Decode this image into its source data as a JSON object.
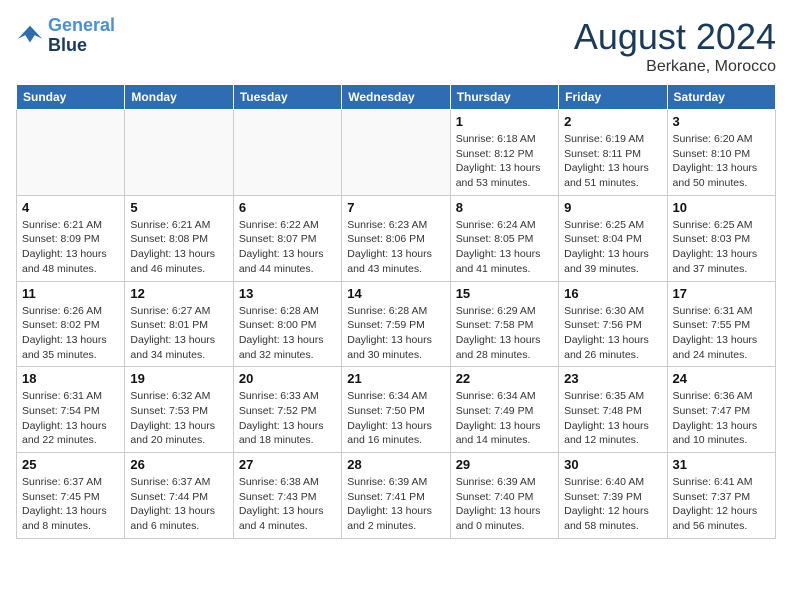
{
  "logo": {
    "line1": "General",
    "line2": "Blue"
  },
  "title": "August 2024",
  "location": "Berkane, Morocco",
  "weekdays": [
    "Sunday",
    "Monday",
    "Tuesday",
    "Wednesday",
    "Thursday",
    "Friday",
    "Saturday"
  ],
  "weeks": [
    [
      {
        "day": "",
        "info": ""
      },
      {
        "day": "",
        "info": ""
      },
      {
        "day": "",
        "info": ""
      },
      {
        "day": "",
        "info": ""
      },
      {
        "day": "1",
        "info": "Sunrise: 6:18 AM\nSunset: 8:12 PM\nDaylight: 13 hours\nand 53 minutes."
      },
      {
        "day": "2",
        "info": "Sunrise: 6:19 AM\nSunset: 8:11 PM\nDaylight: 13 hours\nand 51 minutes."
      },
      {
        "day": "3",
        "info": "Sunrise: 6:20 AM\nSunset: 8:10 PM\nDaylight: 13 hours\nand 50 minutes."
      }
    ],
    [
      {
        "day": "4",
        "info": "Sunrise: 6:21 AM\nSunset: 8:09 PM\nDaylight: 13 hours\nand 48 minutes."
      },
      {
        "day": "5",
        "info": "Sunrise: 6:21 AM\nSunset: 8:08 PM\nDaylight: 13 hours\nand 46 minutes."
      },
      {
        "day": "6",
        "info": "Sunrise: 6:22 AM\nSunset: 8:07 PM\nDaylight: 13 hours\nand 44 minutes."
      },
      {
        "day": "7",
        "info": "Sunrise: 6:23 AM\nSunset: 8:06 PM\nDaylight: 13 hours\nand 43 minutes."
      },
      {
        "day": "8",
        "info": "Sunrise: 6:24 AM\nSunset: 8:05 PM\nDaylight: 13 hours\nand 41 minutes."
      },
      {
        "day": "9",
        "info": "Sunrise: 6:25 AM\nSunset: 8:04 PM\nDaylight: 13 hours\nand 39 minutes."
      },
      {
        "day": "10",
        "info": "Sunrise: 6:25 AM\nSunset: 8:03 PM\nDaylight: 13 hours\nand 37 minutes."
      }
    ],
    [
      {
        "day": "11",
        "info": "Sunrise: 6:26 AM\nSunset: 8:02 PM\nDaylight: 13 hours\nand 35 minutes."
      },
      {
        "day": "12",
        "info": "Sunrise: 6:27 AM\nSunset: 8:01 PM\nDaylight: 13 hours\nand 34 minutes."
      },
      {
        "day": "13",
        "info": "Sunrise: 6:28 AM\nSunset: 8:00 PM\nDaylight: 13 hours\nand 32 minutes."
      },
      {
        "day": "14",
        "info": "Sunrise: 6:28 AM\nSunset: 7:59 PM\nDaylight: 13 hours\nand 30 minutes."
      },
      {
        "day": "15",
        "info": "Sunrise: 6:29 AM\nSunset: 7:58 PM\nDaylight: 13 hours\nand 28 minutes."
      },
      {
        "day": "16",
        "info": "Sunrise: 6:30 AM\nSunset: 7:56 PM\nDaylight: 13 hours\nand 26 minutes."
      },
      {
        "day": "17",
        "info": "Sunrise: 6:31 AM\nSunset: 7:55 PM\nDaylight: 13 hours\nand 24 minutes."
      }
    ],
    [
      {
        "day": "18",
        "info": "Sunrise: 6:31 AM\nSunset: 7:54 PM\nDaylight: 13 hours\nand 22 minutes."
      },
      {
        "day": "19",
        "info": "Sunrise: 6:32 AM\nSunset: 7:53 PM\nDaylight: 13 hours\nand 20 minutes."
      },
      {
        "day": "20",
        "info": "Sunrise: 6:33 AM\nSunset: 7:52 PM\nDaylight: 13 hours\nand 18 minutes."
      },
      {
        "day": "21",
        "info": "Sunrise: 6:34 AM\nSunset: 7:50 PM\nDaylight: 13 hours\nand 16 minutes."
      },
      {
        "day": "22",
        "info": "Sunrise: 6:34 AM\nSunset: 7:49 PM\nDaylight: 13 hours\nand 14 minutes."
      },
      {
        "day": "23",
        "info": "Sunrise: 6:35 AM\nSunset: 7:48 PM\nDaylight: 13 hours\nand 12 minutes."
      },
      {
        "day": "24",
        "info": "Sunrise: 6:36 AM\nSunset: 7:47 PM\nDaylight: 13 hours\nand 10 minutes."
      }
    ],
    [
      {
        "day": "25",
        "info": "Sunrise: 6:37 AM\nSunset: 7:45 PM\nDaylight: 13 hours\nand 8 minutes."
      },
      {
        "day": "26",
        "info": "Sunrise: 6:37 AM\nSunset: 7:44 PM\nDaylight: 13 hours\nand 6 minutes."
      },
      {
        "day": "27",
        "info": "Sunrise: 6:38 AM\nSunset: 7:43 PM\nDaylight: 13 hours\nand 4 minutes."
      },
      {
        "day": "28",
        "info": "Sunrise: 6:39 AM\nSunset: 7:41 PM\nDaylight: 13 hours\nand 2 minutes."
      },
      {
        "day": "29",
        "info": "Sunrise: 6:39 AM\nSunset: 7:40 PM\nDaylight: 13 hours\nand 0 minutes."
      },
      {
        "day": "30",
        "info": "Sunrise: 6:40 AM\nSunset: 7:39 PM\nDaylight: 12 hours\nand 58 minutes."
      },
      {
        "day": "31",
        "info": "Sunrise: 6:41 AM\nSunset: 7:37 PM\nDaylight: 12 hours\nand 56 minutes."
      }
    ]
  ]
}
